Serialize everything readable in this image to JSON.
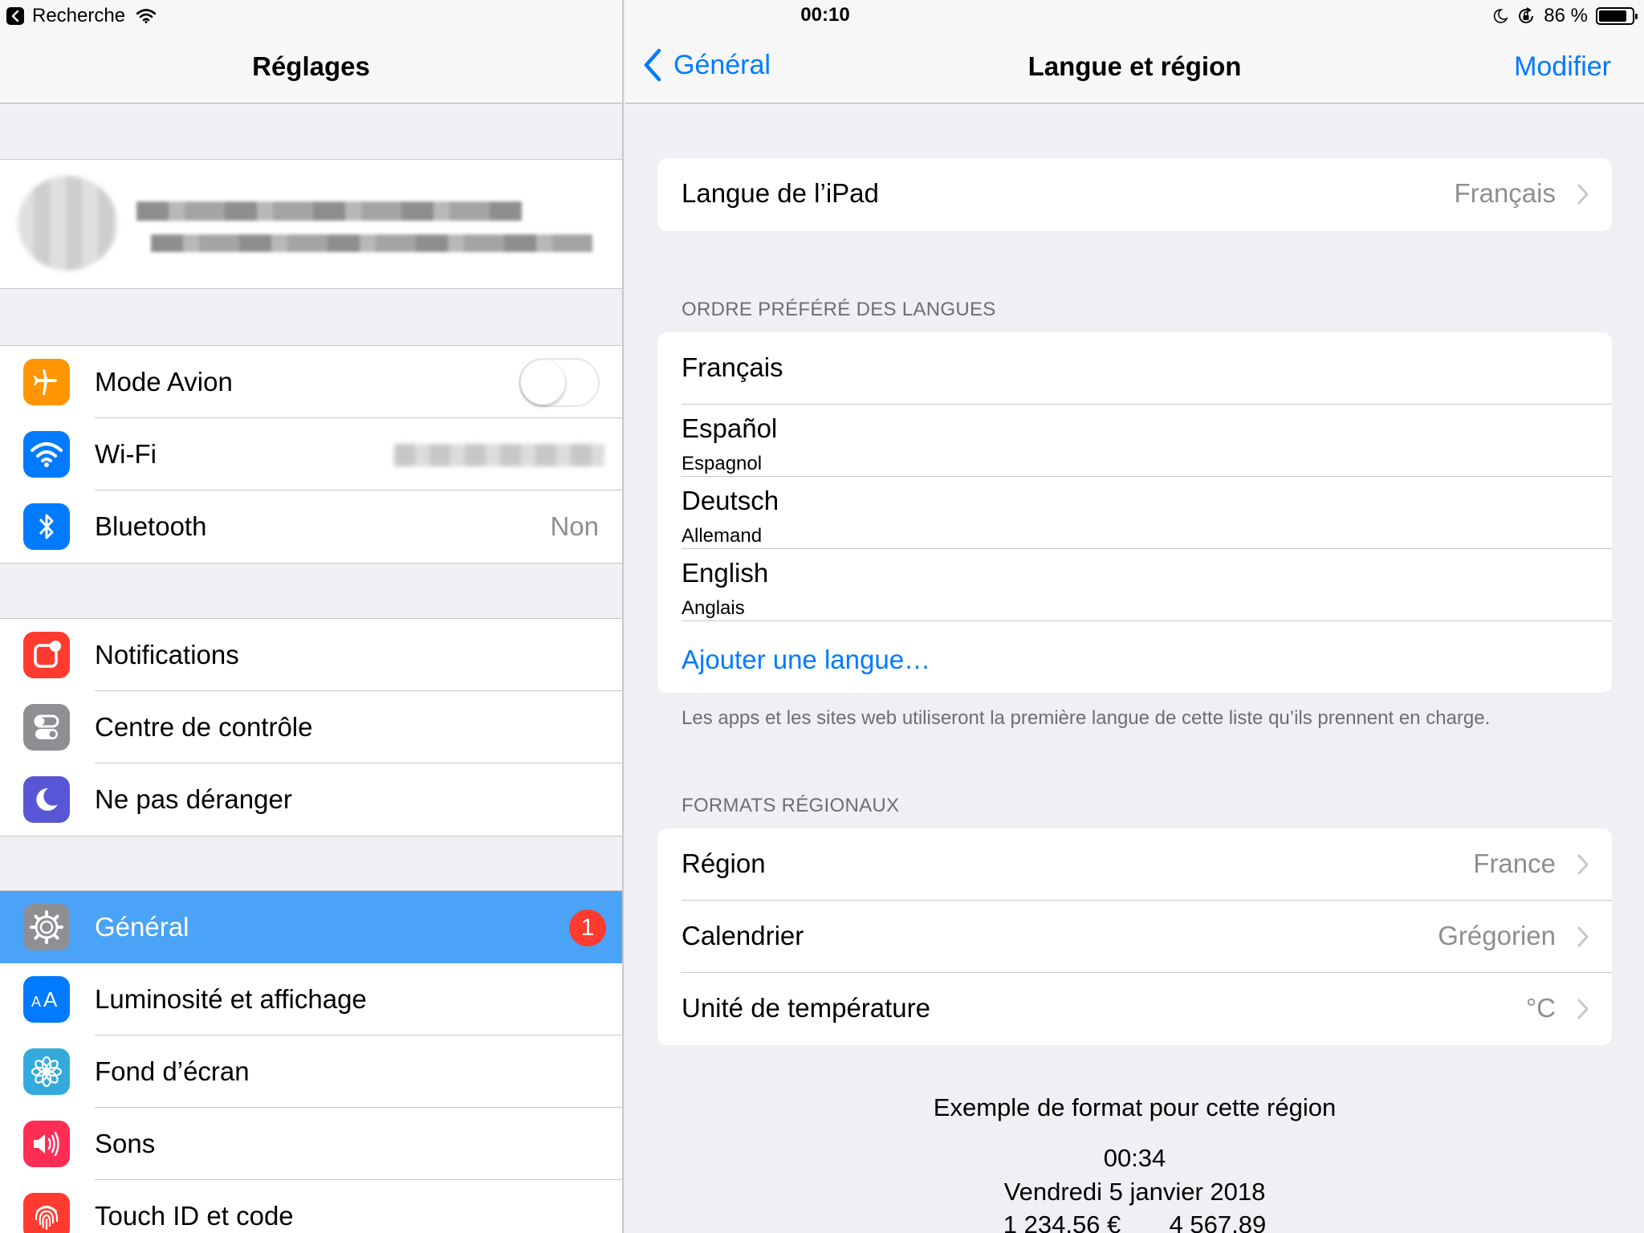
{
  "status_bar": {
    "back_app": "Recherche",
    "time": "00:10",
    "battery": "86 %",
    "battery_level": 0.86
  },
  "master": {
    "title": "Réglages",
    "group1": [
      {
        "label": "Mode Avion",
        "icon": "airplane-icon",
        "color": "#ff9500",
        "toggle": false
      },
      {
        "label": "Wi-Fi",
        "icon": "wifi-icon",
        "color": "#007aff"
      },
      {
        "label": "Bluetooth",
        "icon": "bluetooth-icon",
        "color": "#007aff",
        "value": "Non"
      }
    ],
    "group2": [
      {
        "label": "Notifications",
        "icon": "notifications-icon",
        "color": "#ff3b30"
      },
      {
        "label": "Centre de contrôle",
        "icon": "control-center-icon",
        "color": "#8e8e93"
      },
      {
        "label": "Ne pas déranger",
        "icon": "moon-icon",
        "color": "#5856d6"
      }
    ],
    "group3": [
      {
        "label": "Général",
        "icon": "gear-icon",
        "color": "#8e8e93",
        "badge": "1",
        "selected": true
      },
      {
        "label": "Luminosité et affichage",
        "icon": "text-size-icon",
        "color": "#007aff"
      },
      {
        "label": "Fond d’écran",
        "icon": "wallpaper-icon",
        "color": "#34aadc"
      },
      {
        "label": "Sons",
        "icon": "speaker-icon",
        "color": "#ff2d55"
      },
      {
        "label": "Touch ID et code",
        "icon": "fingerprint-icon",
        "color": "#ff3b30"
      }
    ]
  },
  "detail": {
    "back_label": "Général",
    "title": "Langue et région",
    "edit_label": "Modifier",
    "ipad_language": {
      "label": "Langue de l’iPad",
      "value": "Français"
    },
    "preferred_header": "ORDRE PRÉFÉRÉ DES LANGUES",
    "languages": [
      {
        "name": "Français",
        "sub": ""
      },
      {
        "name": "Español",
        "sub": "Espagnol"
      },
      {
        "name": "Deutsch",
        "sub": "Allemand"
      },
      {
        "name": "English",
        "sub": "Anglais"
      }
    ],
    "add_language": "Ajouter une langue…",
    "languages_footer": "Les apps et les sites web utiliseront la première langue de cette liste qu’ils prennent en charge.",
    "regional_header": "FORMATS RÉGIONAUX",
    "regional": [
      {
        "label": "Région",
        "value": "France"
      },
      {
        "label": "Calendrier",
        "value": "Grégorien"
      },
      {
        "label": "Unité de température",
        "value": "°C"
      }
    ],
    "example": {
      "title": "Exemple de format pour cette région",
      "time": "00:34",
      "date": "Vendredi 5 janvier 2018",
      "numbers": "1 234,56 €       4 567,89"
    }
  },
  "colors": {
    "accent": "#007aff",
    "selected_row": "#4aa3f7",
    "badge": "#ff3b30"
  }
}
